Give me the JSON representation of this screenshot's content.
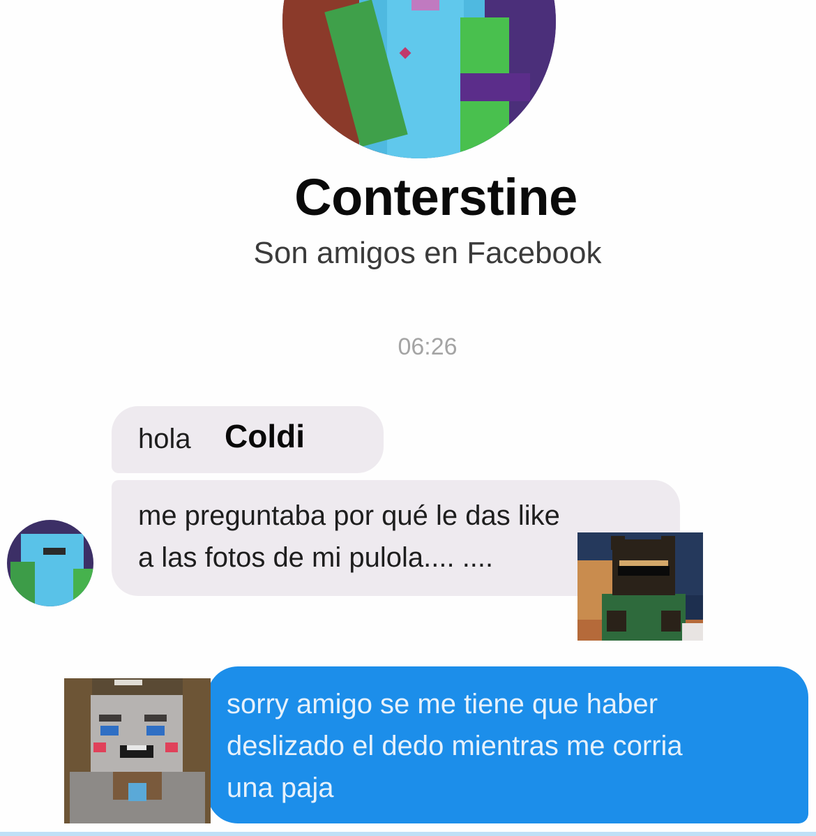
{
  "contact": {
    "name": "Conterstine",
    "friendship_note": "Son amigos en Facebook"
  },
  "conversation": {
    "timestamp": "06:26",
    "incoming": [
      {
        "prefix": "hola",
        "name": "Coldi"
      },
      {
        "line1": "me preguntaba por qué le das like",
        "line2": "a las fotos de mi pulola.... ...."
      }
    ],
    "outgoing": {
      "line1": "sorry amigo se me tiene que haber",
      "line2": "deslizado el dedo mientras me corria",
      "line3": "una paja"
    }
  },
  "colors": {
    "incoming_bubble": "#eeeaef",
    "outgoing_bubble": "#1c8eea",
    "timestamp": "#a4a4a4"
  }
}
